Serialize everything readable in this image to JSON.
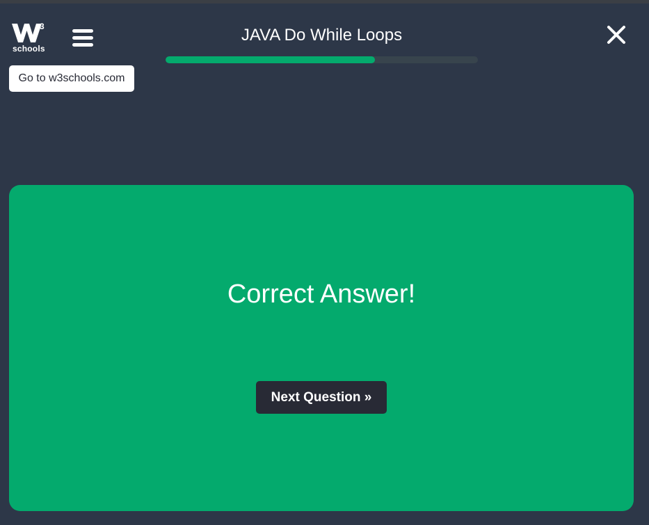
{
  "header": {
    "logo_text": "schools",
    "title": "JAVA Do While Loops",
    "progress_percent": 67,
    "goto_label": "Go to w3schools.com"
  },
  "icons": {
    "logo": "w3schools-logo-icon",
    "menu": "hamburger-menu-icon",
    "close": "close-icon"
  },
  "result": {
    "message": "Correct Answer!",
    "next_label": "Next Question »"
  },
  "colors": {
    "background": "#2d3748",
    "accent_green": "#04aa6d",
    "progress_track": "#38444d",
    "button_dark": "#282a35"
  }
}
